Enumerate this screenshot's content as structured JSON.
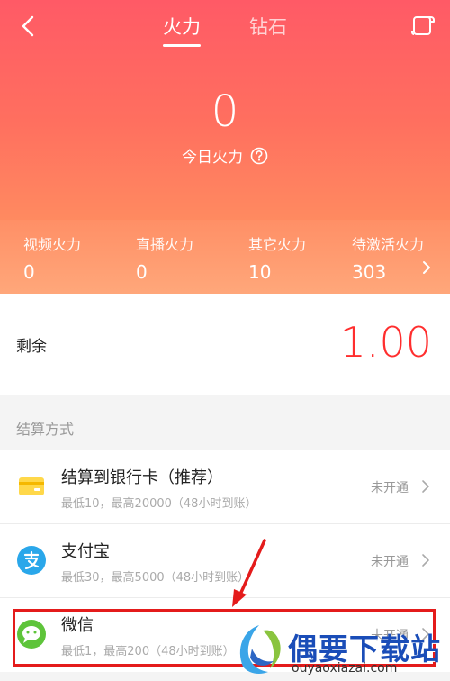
{
  "header": {
    "tabs": [
      {
        "label": "火力",
        "active": true
      },
      {
        "label": "钻石",
        "active": false
      }
    ]
  },
  "hero": {
    "value": "0",
    "caption": "今日火力"
  },
  "stats": [
    {
      "label": "视频火力",
      "value": "0"
    },
    {
      "label": "直播火力",
      "value": "0"
    },
    {
      "label": "其它火力",
      "value": "10"
    },
    {
      "label": "待激活火力",
      "value": "303"
    }
  ],
  "balance": {
    "label": "剩余",
    "value": "1.00"
  },
  "settlement": {
    "section_title": "结算方式",
    "methods": [
      {
        "title": "结算到银行卡（推荐）",
        "subtitle": "最低10，最高20000（48小时到账）",
        "status": "未开通",
        "icon": "bank-card-icon"
      },
      {
        "title": "支付宝",
        "subtitle": "最低30，最高5000（48小时到账）",
        "status": "未开通",
        "icon": "alipay-icon"
      },
      {
        "title": "微信",
        "subtitle": "最低1，最高200（48小时到账）",
        "status": "未开通",
        "icon": "wechat-icon"
      }
    ]
  },
  "watermark": {
    "title": "偶要下载站",
    "url": "ouyaoxiazai.com"
  },
  "colors": {
    "hero_top": "#ff5a66",
    "hero_bottom": "#ff8a60",
    "balance_value": "#ff2e2e",
    "annotation": "#e41b1b"
  }
}
